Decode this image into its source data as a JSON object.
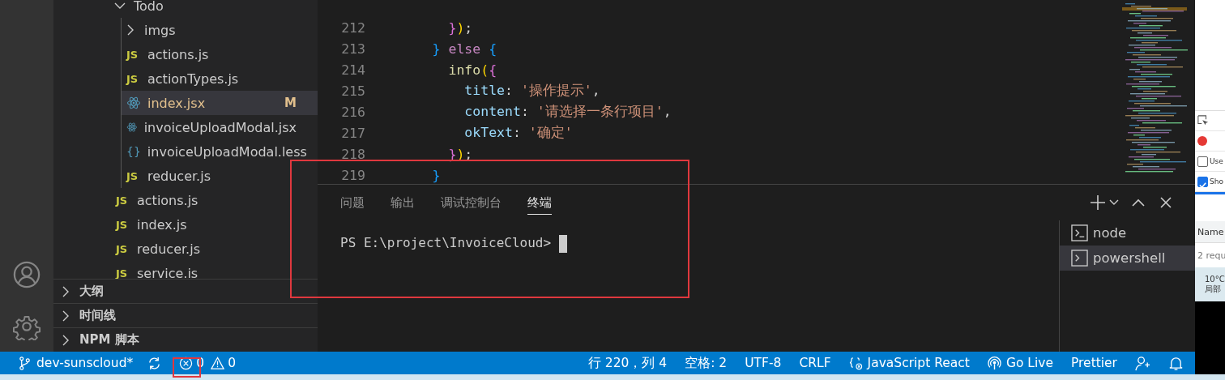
{
  "explorer": {
    "tree": [
      {
        "label": "Todo",
        "kind": "folder",
        "expanded": true,
        "selected": false,
        "children": [
          {
            "label": "imgs",
            "kind": "folder",
            "expanded": false,
            "selected": false
          },
          {
            "label": "actions.js",
            "kind": "js",
            "icon": "JS",
            "selected": false
          },
          {
            "label": "actionTypes.js",
            "kind": "js",
            "icon": "JS",
            "selected": false
          },
          {
            "label": "index.jsx",
            "kind": "react",
            "selected": true,
            "badge": "M"
          },
          {
            "label": "invoiceUploadModal.jsx",
            "kind": "react",
            "selected": false
          },
          {
            "label": "invoiceUploadModal.less",
            "kind": "less",
            "icon": "{}",
            "selected": false
          },
          {
            "label": "reducer.js",
            "kind": "js",
            "icon": "JS",
            "selected": false
          }
        ]
      },
      {
        "label": "actions.js",
        "kind": "js",
        "icon": "JS",
        "selected": false
      },
      {
        "label": "index.js",
        "kind": "js",
        "icon": "JS",
        "selected": false
      },
      {
        "label": "reducer.js",
        "kind": "js",
        "icon": "JS",
        "selected": false
      },
      {
        "label": "service.is",
        "kind": "js",
        "icon": "JS",
        "selected": false
      }
    ],
    "sections": [
      {
        "label": "大纲",
        "expanded": false
      },
      {
        "label": "时间线",
        "expanded": false
      },
      {
        "label": "NPM 脚本",
        "expanded": false
      }
    ]
  },
  "editor": {
    "lines": [
      {
        "number": "212",
        "tokens": [
          {
            "kind": "b2",
            "text": "        }"
          },
          {
            "kind": "b1",
            "text": ")"
          },
          {
            "kind": "plain",
            "text": ";"
          }
        ]
      },
      {
        "number": "213",
        "tokens": [
          {
            "kind": "b3",
            "text": "      }"
          },
          {
            "kind": "keyword",
            "text": " else "
          },
          {
            "kind": "b3",
            "text": "{"
          }
        ]
      },
      {
        "number": "214",
        "tokens": [
          {
            "kind": "func",
            "text": "        info"
          },
          {
            "kind": "b1",
            "text": "("
          },
          {
            "kind": "b2",
            "text": "{"
          }
        ]
      },
      {
        "number": "215",
        "tokens": [
          {
            "kind": "prop",
            "text": "          title"
          },
          {
            "kind": "plain",
            "text": ": "
          },
          {
            "kind": "string",
            "text": "'操作提示'"
          },
          {
            "kind": "plain",
            "text": ","
          }
        ]
      },
      {
        "number": "216",
        "tokens": [
          {
            "kind": "prop",
            "text": "          content"
          },
          {
            "kind": "plain",
            "text": ": "
          },
          {
            "kind": "string",
            "text": "'请选择一条行项目'"
          },
          {
            "kind": "plain",
            "text": ","
          }
        ]
      },
      {
        "number": "217",
        "tokens": [
          {
            "kind": "prop",
            "text": "          okText"
          },
          {
            "kind": "plain",
            "text": ": "
          },
          {
            "kind": "string",
            "text": "'确定'"
          }
        ]
      },
      {
        "number": "218",
        "tokens": [
          {
            "kind": "b2",
            "text": "        }"
          },
          {
            "kind": "b1",
            "text": ")"
          },
          {
            "kind": "plain",
            "text": ";"
          }
        ]
      },
      {
        "number": "219",
        "tokens": [
          {
            "kind": "b3",
            "text": "      }"
          }
        ]
      }
    ]
  },
  "panel": {
    "tabs": [
      {
        "label": "问题",
        "selected": false
      },
      {
        "label": "输出",
        "selected": false
      },
      {
        "label": "调试控制台",
        "selected": false
      },
      {
        "label": "终端",
        "selected": true
      }
    ],
    "prompt": "PS E:\\project\\InvoiceCloud>",
    "terminals": [
      {
        "label": "node",
        "selected": false
      },
      {
        "label": "powershell",
        "selected": true
      }
    ]
  },
  "status_bar": {
    "branch": "dev-sunscloud*",
    "errors": "0",
    "warnings": "0",
    "items": [
      {
        "kind": "text",
        "label": "行 220，列 4"
      },
      {
        "kind": "text",
        "label": "空格: 2"
      },
      {
        "kind": "text",
        "label": "UTF-8"
      },
      {
        "kind": "text",
        "label": "CRLF"
      },
      {
        "kind": "language",
        "label": "JavaScript React"
      },
      {
        "kind": "live",
        "label": "Go Live"
      },
      {
        "kind": "text",
        "label": "Prettier"
      }
    ]
  },
  "browser": {
    "options": [
      {
        "label": "Use",
        "checked": false
      },
      {
        "label": "Sho",
        "checked": true
      }
    ],
    "column": "Name",
    "requests": "2 requ",
    "temperature": "10°C",
    "weather": "局部"
  }
}
